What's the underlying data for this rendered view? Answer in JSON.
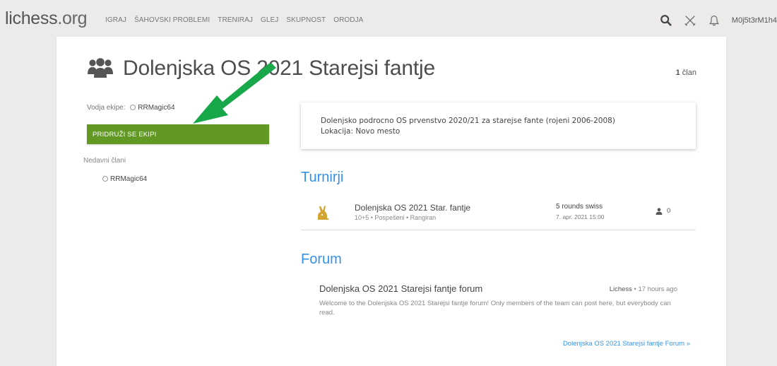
{
  "header": {
    "logo": "lichess",
    "logo_tld": ".org",
    "nav": [
      "IGRAJ",
      "ŠAHOVSKI PROBLEMI",
      "TRENIRAJ",
      "GLEJ",
      "SKUPNOST",
      "ORODJA"
    ],
    "icons": [
      "search-icon",
      "crossed-swords-icon",
      "bell-icon"
    ],
    "username": "M0j5t3rM1h4"
  },
  "team": {
    "title": "Dolenjska OS 2021 Starejsi fantje",
    "member_count": "1",
    "member_word": " član",
    "leader_label": "Vodja ekipe:",
    "leader_name": "RRMagic64",
    "join_label": "PRIDRUŽI SE EKIPI",
    "recent_label": "Nedavni člani",
    "recent_members": [
      "RRMagic64"
    ],
    "description_line1": "Dolenjsko podrocno OS prvenstvo 2020/21 za starejse fante (rojeni 2006-2008)",
    "description_line2": "Lokacija: Novo mesto"
  },
  "tournaments": {
    "title": "Turnirji",
    "items": [
      {
        "name": "Dolenjska OS 2021 Star. fantje",
        "meta": "10+5 • Pospešeni • Rangiran",
        "format": "5 rounds swiss",
        "date": "7. apr. 2021 15:00",
        "players": "0"
      }
    ]
  },
  "forum": {
    "title": "Forum",
    "post_title": "Dolenjska OS 2021 Starejsi fantje forum",
    "post_author": "Lichess",
    "post_time": " • 17 hours ago",
    "post_body": "Welcome to the Dolenjska OS 2021 Starejsi fantje forum! Only members of the team can post here, but everybody can read.",
    "link": "Dolenjska OS 2021 Starejsi fantje Forum »"
  },
  "colors": {
    "accent_blue": "#3692e7",
    "join_green": "#629924",
    "arrow_green": "#18a84a",
    "tournament_icon": "#d4a431"
  }
}
